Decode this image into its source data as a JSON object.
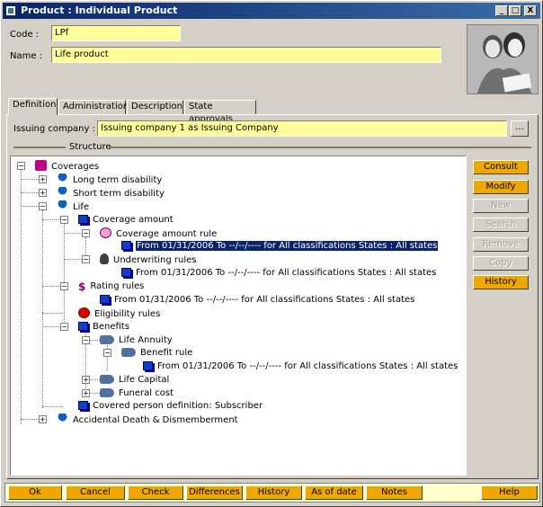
{
  "window": {
    "title": "Product : Individual Product",
    "controls": {
      "minimize": "_",
      "maximize": "□",
      "close": "X"
    }
  },
  "form": {
    "code_label": "Code :",
    "code_value": "LPf",
    "name_label": "Name :",
    "name_value": "Life product"
  },
  "tabs": [
    {
      "label": "Definition",
      "active": true
    },
    {
      "label": "Administration",
      "active": false
    },
    {
      "label": "Description",
      "active": false
    },
    {
      "label": "State approvals",
      "active": false
    }
  ],
  "issuing": {
    "label": "Issuing company :",
    "value": "Issuing company 1 as Issuing Company",
    "browse_label": "..."
  },
  "structure_label": "Structure",
  "tree": [
    {
      "label": "Coverages",
      "icon": "gift-icon"
    },
    {
      "label": "Long term disability",
      "icon": "umbrella-icon"
    },
    {
      "label": "Short term disability",
      "icon": "umbrella-icon"
    },
    {
      "label": "Life",
      "icon": "umbrella-icon"
    },
    {
      "label": "Coverage amount",
      "icon": "cube-icon"
    },
    {
      "label": "Coverage amount rule",
      "icon": "piggy-bank-icon"
    },
    {
      "label": "From 01/31/2006 To --/--/---- for All classifications    States : All states",
      "icon": "cube-icon",
      "selected": true
    },
    {
      "label": "Underwriting rules",
      "icon": "head-icon"
    },
    {
      "label": "From 01/31/2006 To --/--/---- for All classifications    States : All states",
      "icon": "cube-icon"
    },
    {
      "label": "Rating rules",
      "icon": "dollar-icon"
    },
    {
      "label": "From 01/31/2006 To --/--/---- for All classifications    States : All states",
      "icon": "cube-icon"
    },
    {
      "label": "Eligibility rules",
      "icon": "stop-icon"
    },
    {
      "label": "Benefits",
      "icon": "cube-icon"
    },
    {
      "label": "Life Annuity",
      "icon": "hand-icon"
    },
    {
      "label": "Benefit rule",
      "icon": "hand-icon"
    },
    {
      "label": "From 01/31/2006 To --/--/---- for All classifications    States : All states",
      "icon": "cube-icon"
    },
    {
      "label": "Life Capital",
      "icon": "hand-icon"
    },
    {
      "label": "Funeral cost",
      "icon": "hand-icon"
    },
    {
      "label": "Covered person definition: Subscriber",
      "icon": "cube-icon"
    },
    {
      "label": "Accidental Death & Dismemberment",
      "icon": "umbrella-icon"
    }
  ],
  "side_buttons": [
    {
      "label": "Consult",
      "enabled": true
    },
    {
      "label": "Modify",
      "enabled": true
    },
    {
      "label": "New",
      "enabled": false
    },
    {
      "label": "Search",
      "enabled": false
    },
    {
      "label": "Remove",
      "enabled": false
    },
    {
      "label": "Copy",
      "enabled": false
    },
    {
      "label": "History",
      "enabled": true
    }
  ],
  "bottom_buttons": [
    {
      "label": "Ok"
    },
    {
      "label": "Cancel"
    },
    {
      "label": "Check"
    },
    {
      "label": "Differences"
    },
    {
      "label": "History"
    },
    {
      "label": "As of date"
    },
    {
      "label": "Notes"
    },
    {
      "label": "Help"
    }
  ],
  "colors": {
    "field_bg": "#ffff99",
    "button_bg": "#f0a800",
    "titlebar": "#0a246a",
    "selection": "#0a246a"
  }
}
